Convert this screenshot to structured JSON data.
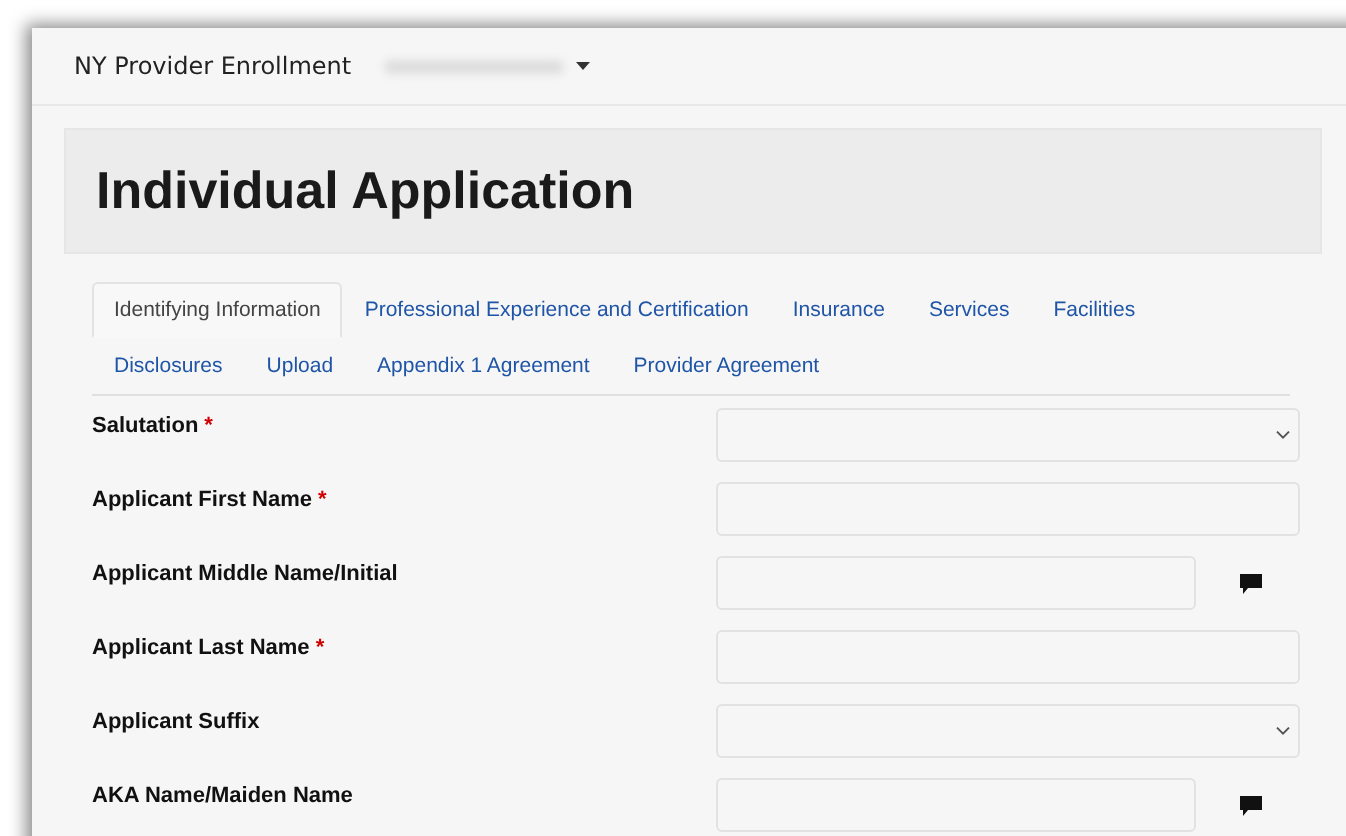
{
  "navbar": {
    "brand": "NY Provider Enrollment"
  },
  "header": {
    "title": "Individual Application"
  },
  "tabs": [
    {
      "label": "Identifying Information",
      "selected": true
    },
    {
      "label": "Professional Experience and Certification",
      "selected": false
    },
    {
      "label": "Insurance",
      "selected": false
    },
    {
      "label": "Services",
      "selected": false
    },
    {
      "label": "Facilities",
      "selected": false
    },
    {
      "label": "Disclosures",
      "selected": false
    },
    {
      "label": "Upload",
      "selected": false
    },
    {
      "label": "Appendix 1 Agreement",
      "selected": false
    },
    {
      "label": "Provider Agreement",
      "selected": false
    }
  ],
  "fields": [
    {
      "label": "Salutation",
      "required_mark": "*",
      "kind": "select",
      "comment": false
    },
    {
      "label": "Applicant First Name",
      "required_mark": "*",
      "kind": "text",
      "comment": false
    },
    {
      "label": "Applicant Middle Name/Initial",
      "kind": "text",
      "comment": true
    },
    {
      "label": "Applicant Last Name",
      "required_mark": "*",
      "kind": "text",
      "comment": false
    },
    {
      "label": "Applicant Suffix",
      "kind": "select",
      "comment": false
    },
    {
      "label": "AKA Name/Maiden Name",
      "kind": "text",
      "comment": true
    }
  ]
}
